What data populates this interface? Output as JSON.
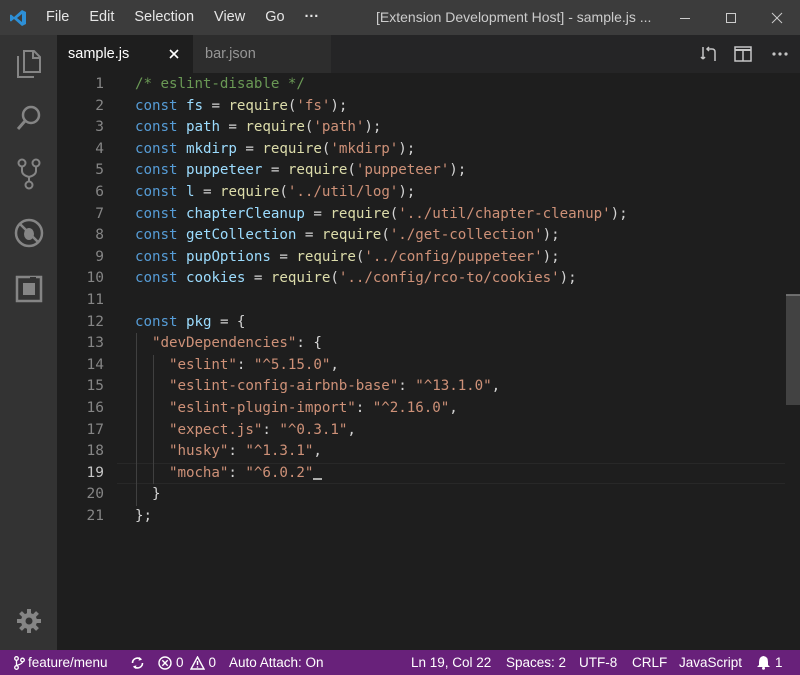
{
  "app": {
    "window_title": "[Extension Development Host] - sample.js ...",
    "menu": [
      "File",
      "Edit",
      "Selection",
      "View",
      "Go",
      "···"
    ],
    "accent": "#68217a"
  },
  "activity_bar": {
    "items": [
      "files-icon",
      "search-icon",
      "source-control-icon",
      "debug-icon",
      "extensions-icon"
    ],
    "bottom": "gear-icon"
  },
  "tabs": [
    {
      "label": "sample.js",
      "active": true
    },
    {
      "label": "bar.json",
      "active": false
    }
  ],
  "editor": {
    "line_numbers": [
      "1",
      "2",
      "3",
      "4",
      "5",
      "6",
      "7",
      "8",
      "9",
      "10",
      "11",
      "12",
      "13",
      "14",
      "15",
      "16",
      "17",
      "18",
      "19",
      "20",
      "21"
    ],
    "current_line": "19",
    "lines": [
      [
        [
          "cm",
          "/* eslint-disable */"
        ]
      ],
      [
        [
          "kw",
          "const"
        ],
        [
          "pn",
          " "
        ],
        [
          "vr",
          "fs"
        ],
        [
          "pn",
          " = "
        ],
        [
          "fn",
          "require"
        ],
        [
          "pn",
          "("
        ],
        [
          "str",
          "'fs'"
        ],
        [
          "pn",
          ");"
        ]
      ],
      [
        [
          "kw",
          "const"
        ],
        [
          "pn",
          " "
        ],
        [
          "vr",
          "path"
        ],
        [
          "pn",
          " = "
        ],
        [
          "fn",
          "require"
        ],
        [
          "pn",
          "("
        ],
        [
          "str",
          "'path'"
        ],
        [
          "pn",
          ");"
        ]
      ],
      [
        [
          "kw",
          "const"
        ],
        [
          "pn",
          " "
        ],
        [
          "vr",
          "mkdirp"
        ],
        [
          "pn",
          " = "
        ],
        [
          "fn",
          "require"
        ],
        [
          "pn",
          "("
        ],
        [
          "str",
          "'mkdirp'"
        ],
        [
          "pn",
          ");"
        ]
      ],
      [
        [
          "kw",
          "const"
        ],
        [
          "pn",
          " "
        ],
        [
          "vr",
          "puppeteer"
        ],
        [
          "pn",
          " = "
        ],
        [
          "fn",
          "require"
        ],
        [
          "pn",
          "("
        ],
        [
          "str",
          "'puppeteer'"
        ],
        [
          "pn",
          ");"
        ]
      ],
      [
        [
          "kw",
          "const"
        ],
        [
          "pn",
          " "
        ],
        [
          "vr",
          "l"
        ],
        [
          "pn",
          " = "
        ],
        [
          "fn",
          "require"
        ],
        [
          "pn",
          "("
        ],
        [
          "str",
          "'../util/log'"
        ],
        [
          "pn",
          ");"
        ]
      ],
      [
        [
          "kw",
          "const"
        ],
        [
          "pn",
          " "
        ],
        [
          "vr",
          "chapterCleanup"
        ],
        [
          "pn",
          " = "
        ],
        [
          "fn",
          "require"
        ],
        [
          "pn",
          "("
        ],
        [
          "str",
          "'../util/chapter-cleanup'"
        ],
        [
          "pn",
          ");"
        ]
      ],
      [
        [
          "kw",
          "const"
        ],
        [
          "pn",
          " "
        ],
        [
          "vr",
          "getCollection"
        ],
        [
          "pn",
          " = "
        ],
        [
          "fn",
          "require"
        ],
        [
          "pn",
          "("
        ],
        [
          "str",
          "'./get-collection'"
        ],
        [
          "pn",
          ");"
        ]
      ],
      [
        [
          "kw",
          "const"
        ],
        [
          "pn",
          " "
        ],
        [
          "vr",
          "pupOptions"
        ],
        [
          "pn",
          " = "
        ],
        [
          "fn",
          "require"
        ],
        [
          "pn",
          "("
        ],
        [
          "str",
          "'../config/puppeteer'"
        ],
        [
          "pn",
          ");"
        ]
      ],
      [
        [
          "kw",
          "const"
        ],
        [
          "pn",
          " "
        ],
        [
          "vr",
          "cookies"
        ],
        [
          "pn",
          " = "
        ],
        [
          "fn",
          "require"
        ],
        [
          "pn",
          "("
        ],
        [
          "str",
          "'../config/rco-to/cookies'"
        ],
        [
          "pn",
          ");"
        ]
      ],
      [],
      [
        [
          "kw",
          "const"
        ],
        [
          "pn",
          " "
        ],
        [
          "vr",
          "pkg"
        ],
        [
          "pn",
          " = {"
        ]
      ],
      [
        [
          "pn",
          "  "
        ],
        [
          "str",
          "\"devDependencies\""
        ],
        [
          "pn",
          ": {"
        ]
      ],
      [
        [
          "pn",
          "    "
        ],
        [
          "str",
          "\"eslint\""
        ],
        [
          "pn",
          ": "
        ],
        [
          "str",
          "\"^5.15.0\""
        ],
        [
          "pn",
          ","
        ]
      ],
      [
        [
          "pn",
          "    "
        ],
        [
          "str",
          "\"eslint-config-airbnb-base\""
        ],
        [
          "pn",
          ": "
        ],
        [
          "str",
          "\"^13.1.0\""
        ],
        [
          "pn",
          ","
        ]
      ],
      [
        [
          "pn",
          "    "
        ],
        [
          "str",
          "\"eslint-plugin-import\""
        ],
        [
          "pn",
          ": "
        ],
        [
          "str",
          "\"^2.16.0\""
        ],
        [
          "pn",
          ","
        ]
      ],
      [
        [
          "pn",
          "    "
        ],
        [
          "str",
          "\"expect.js\""
        ],
        [
          "pn",
          ": "
        ],
        [
          "str",
          "\"^0.3.1\""
        ],
        [
          "pn",
          ","
        ]
      ],
      [
        [
          "pn",
          "    "
        ],
        [
          "str",
          "\"husky\""
        ],
        [
          "pn",
          ": "
        ],
        [
          "str",
          "\"^1.3.1\""
        ],
        [
          "pn",
          ","
        ]
      ],
      [
        [
          "pn",
          "    "
        ],
        [
          "str",
          "\"mocha\""
        ],
        [
          "pn",
          ": "
        ],
        [
          "str",
          "\"^6.0.2\""
        ]
      ],
      [
        [
          "pn",
          "  }"
        ]
      ],
      [
        [
          "pn",
          "};"
        ]
      ]
    ]
  },
  "status_bar": {
    "branch": "feature/menu",
    "errors": "0",
    "warnings": "0",
    "auto_attach": "Auto Attach: On",
    "position": "Ln 19, Col 22",
    "spaces": "Spaces: 2",
    "encoding": "UTF-8",
    "eol": "CRLF",
    "language": "JavaScript",
    "notifications": "1"
  }
}
